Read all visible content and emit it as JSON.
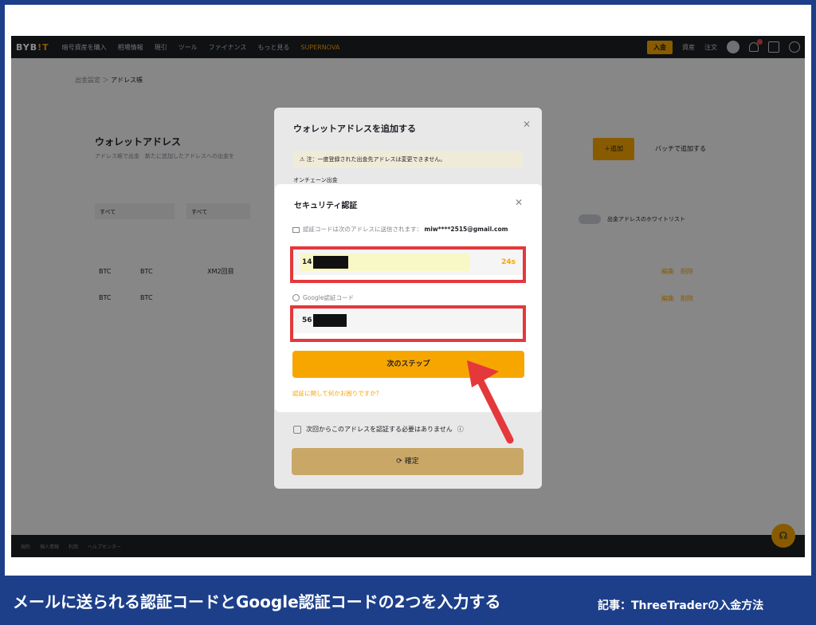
{
  "nav": {
    "logo": "BYB",
    "logo_accent": "!T",
    "items": [
      "暗号資産を購入",
      "相場情報",
      "現引",
      "ツール",
      "ファイナンス",
      "もっと見る"
    ],
    "promo": "SUPERNOVA",
    "deposit_label": "入金",
    "assets_label": "資産",
    "orders_label": "注文"
  },
  "page": {
    "breadcrumb_parent": "出金設定",
    "breadcrumb_current": "アドレス帳",
    "wallet_title": "ウォレットアドレス",
    "filter_hint": "アドレス帳で出金　新たに追加したアドレスへの出金を",
    "select_1": "すべて",
    "select_2": "すべて",
    "add_button": "＋追加",
    "batch_link": "バッチで追加する",
    "whitelist_label": "出金アドレスのホワイトリスト",
    "rows": [
      {
        "coin": "BTC",
        "chain": "BTC",
        "note": "XM2回目",
        "actions": "編集　削除"
      },
      {
        "coin": "BTC",
        "chain": "BTC",
        "note": "",
        "actions": "編集　削除"
      }
    ],
    "footer": [
      "規約",
      "個人情報",
      "利用",
      "ヘルプセンター"
    ]
  },
  "outer_dialog": {
    "title": "ウォレットアドレスを追加する",
    "notice": "注：一度登録された出金先アドレスは変更できません。",
    "onchain_label": "オンチェーン出金",
    "checkbox_label": "次回からこのアドレスを認証する必要はありません",
    "confirm_label": "確定"
  },
  "security_dialog": {
    "title": "セキュリティ認証",
    "email_prompt": "認証コードは次のアドレスに送信されます：",
    "email": "miw****2515@gmail.com",
    "email_code_value": "14",
    "countdown": "24s",
    "google_label": "Google認証コード",
    "google_code_value": "56",
    "next_button": "次のステップ",
    "help_link": "認証に関して何かお困りですか？"
  },
  "caption": {
    "main": "メールに送られる認証コードとGoogle認証コードの2つを入力する",
    "right": "記事：ThreeTraderの入金方法"
  },
  "colors": {
    "accent": "#f7a600",
    "highlight": "#e5383b",
    "caption_bg": "#1d3f8a"
  }
}
